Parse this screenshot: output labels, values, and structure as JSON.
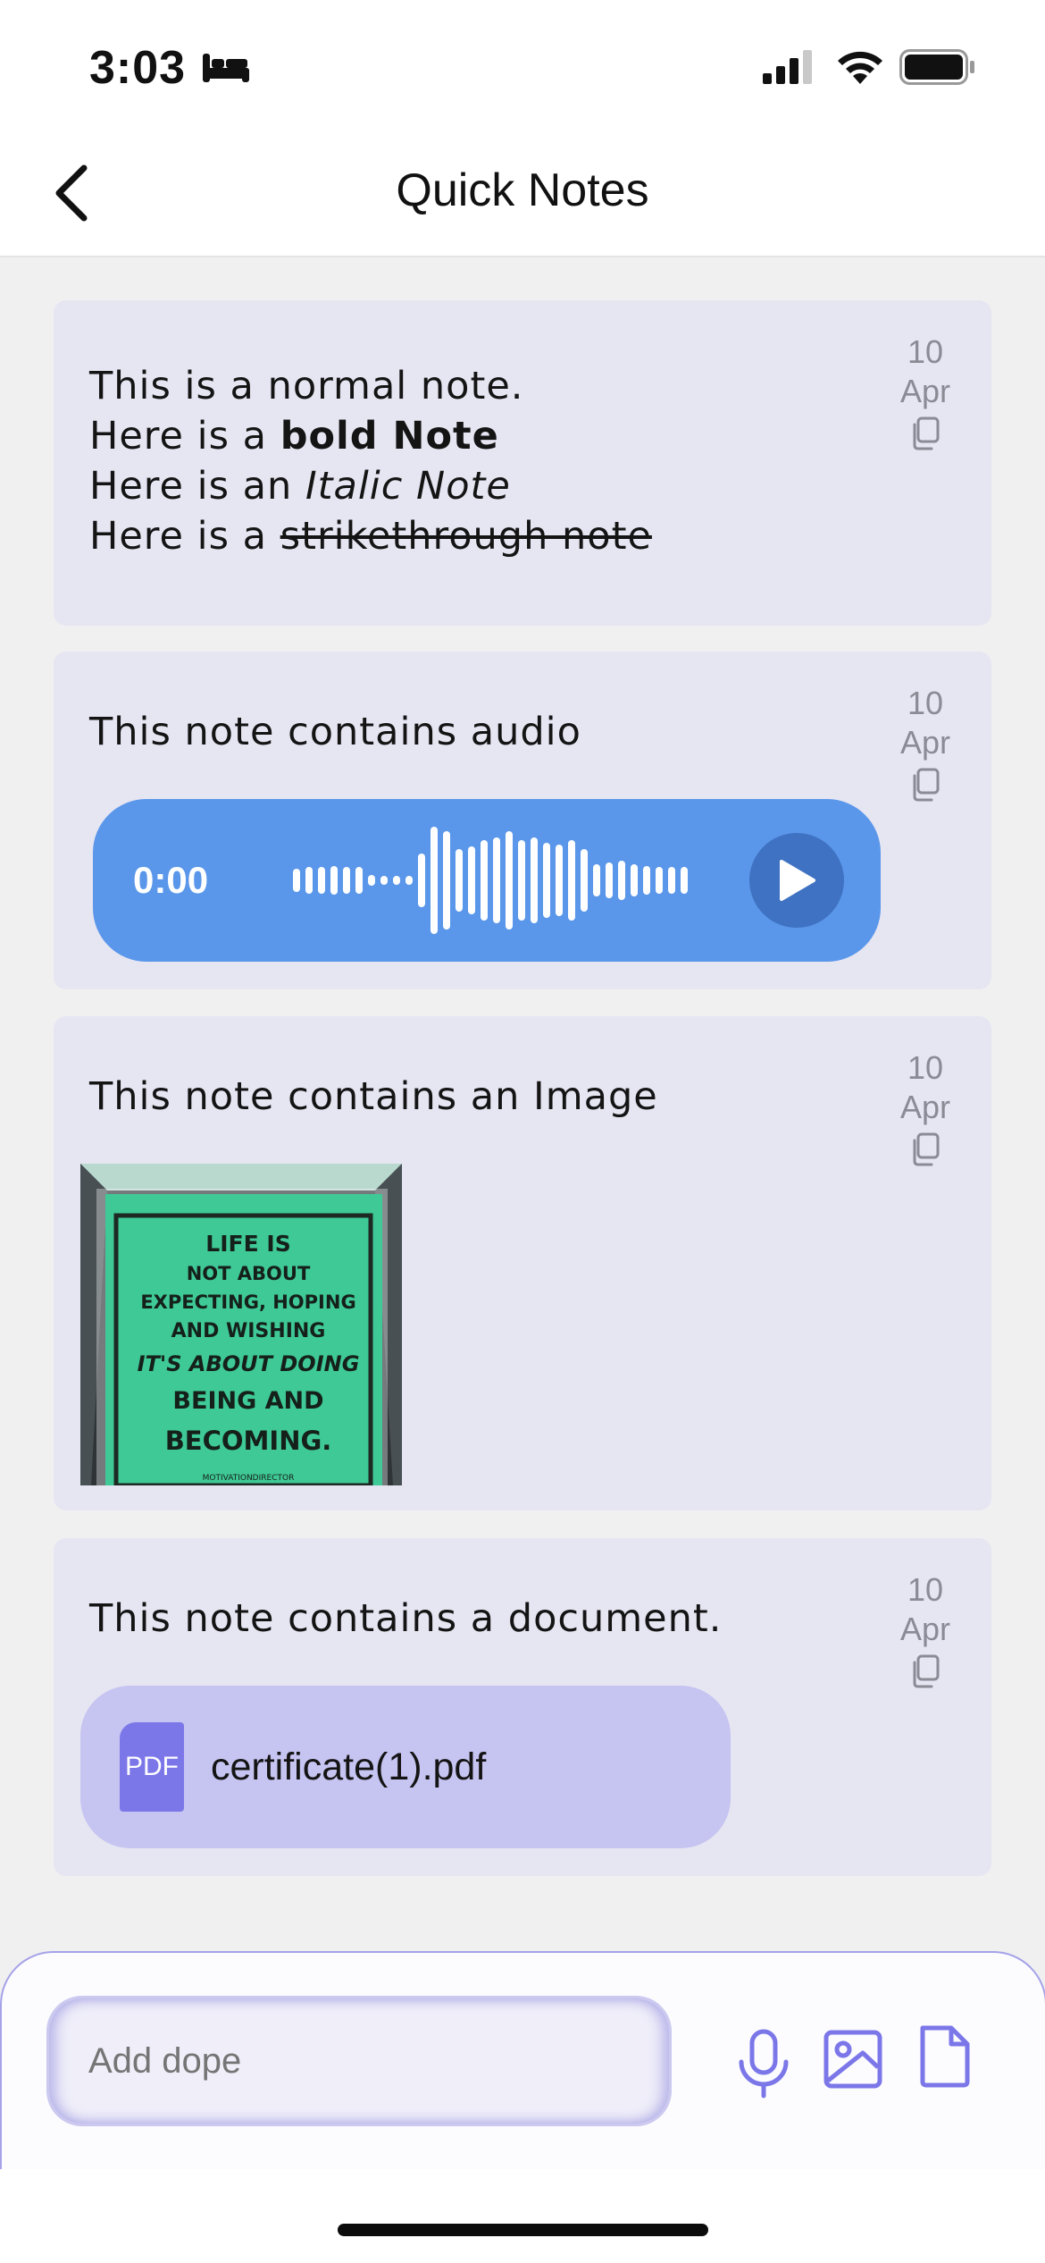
{
  "status_bar": {
    "time": "3:03"
  },
  "header": {
    "title": "Quick Notes"
  },
  "notes": [
    {
      "date_day": "10",
      "date_month": "Apr",
      "lines": {
        "line1": "This is a normal note.",
        "line2_prefix": "Here is a ",
        "line2_bold": "bold Note",
        "line3_prefix": "Here is an ",
        "line3_italic": "Italic Note",
        "line4_prefix": "Here is a ",
        "line4_strike": "strikethrough note"
      }
    },
    {
      "date_day": "10",
      "date_month": "Apr",
      "text": "This note contains audio",
      "audio": {
        "time": "0:00"
      }
    },
    {
      "date_day": "10",
      "date_month": "Apr",
      "text": "This note contains an Image",
      "image": {
        "poster_lines": [
          "LIFE IS",
          "NOT ABOUT",
          "EXPECTING, HOPING",
          "AND WISHING",
          "IT'S ABOUT DOING",
          "BEING AND",
          "BECOMING."
        ],
        "credit": "MOTIVATIONDIRECTOR"
      }
    },
    {
      "date_day": "10",
      "date_month": "Apr",
      "text": "This note contains a document.",
      "document": {
        "badge": "PDF",
        "filename": "certificate(1).pdf"
      }
    }
  ],
  "composer": {
    "placeholder": "Add dope"
  },
  "icons": {
    "back": "chevron-left-icon",
    "copy": "copy-icon",
    "play": "play-icon",
    "mic": "microphone-icon",
    "image": "image-icon",
    "document": "document-icon"
  },
  "colors": {
    "card_bg": "#e6e5f2",
    "audio_bg": "#5a97ea",
    "doc_bg": "#c6c4f1",
    "accent": "#7c77e8"
  }
}
